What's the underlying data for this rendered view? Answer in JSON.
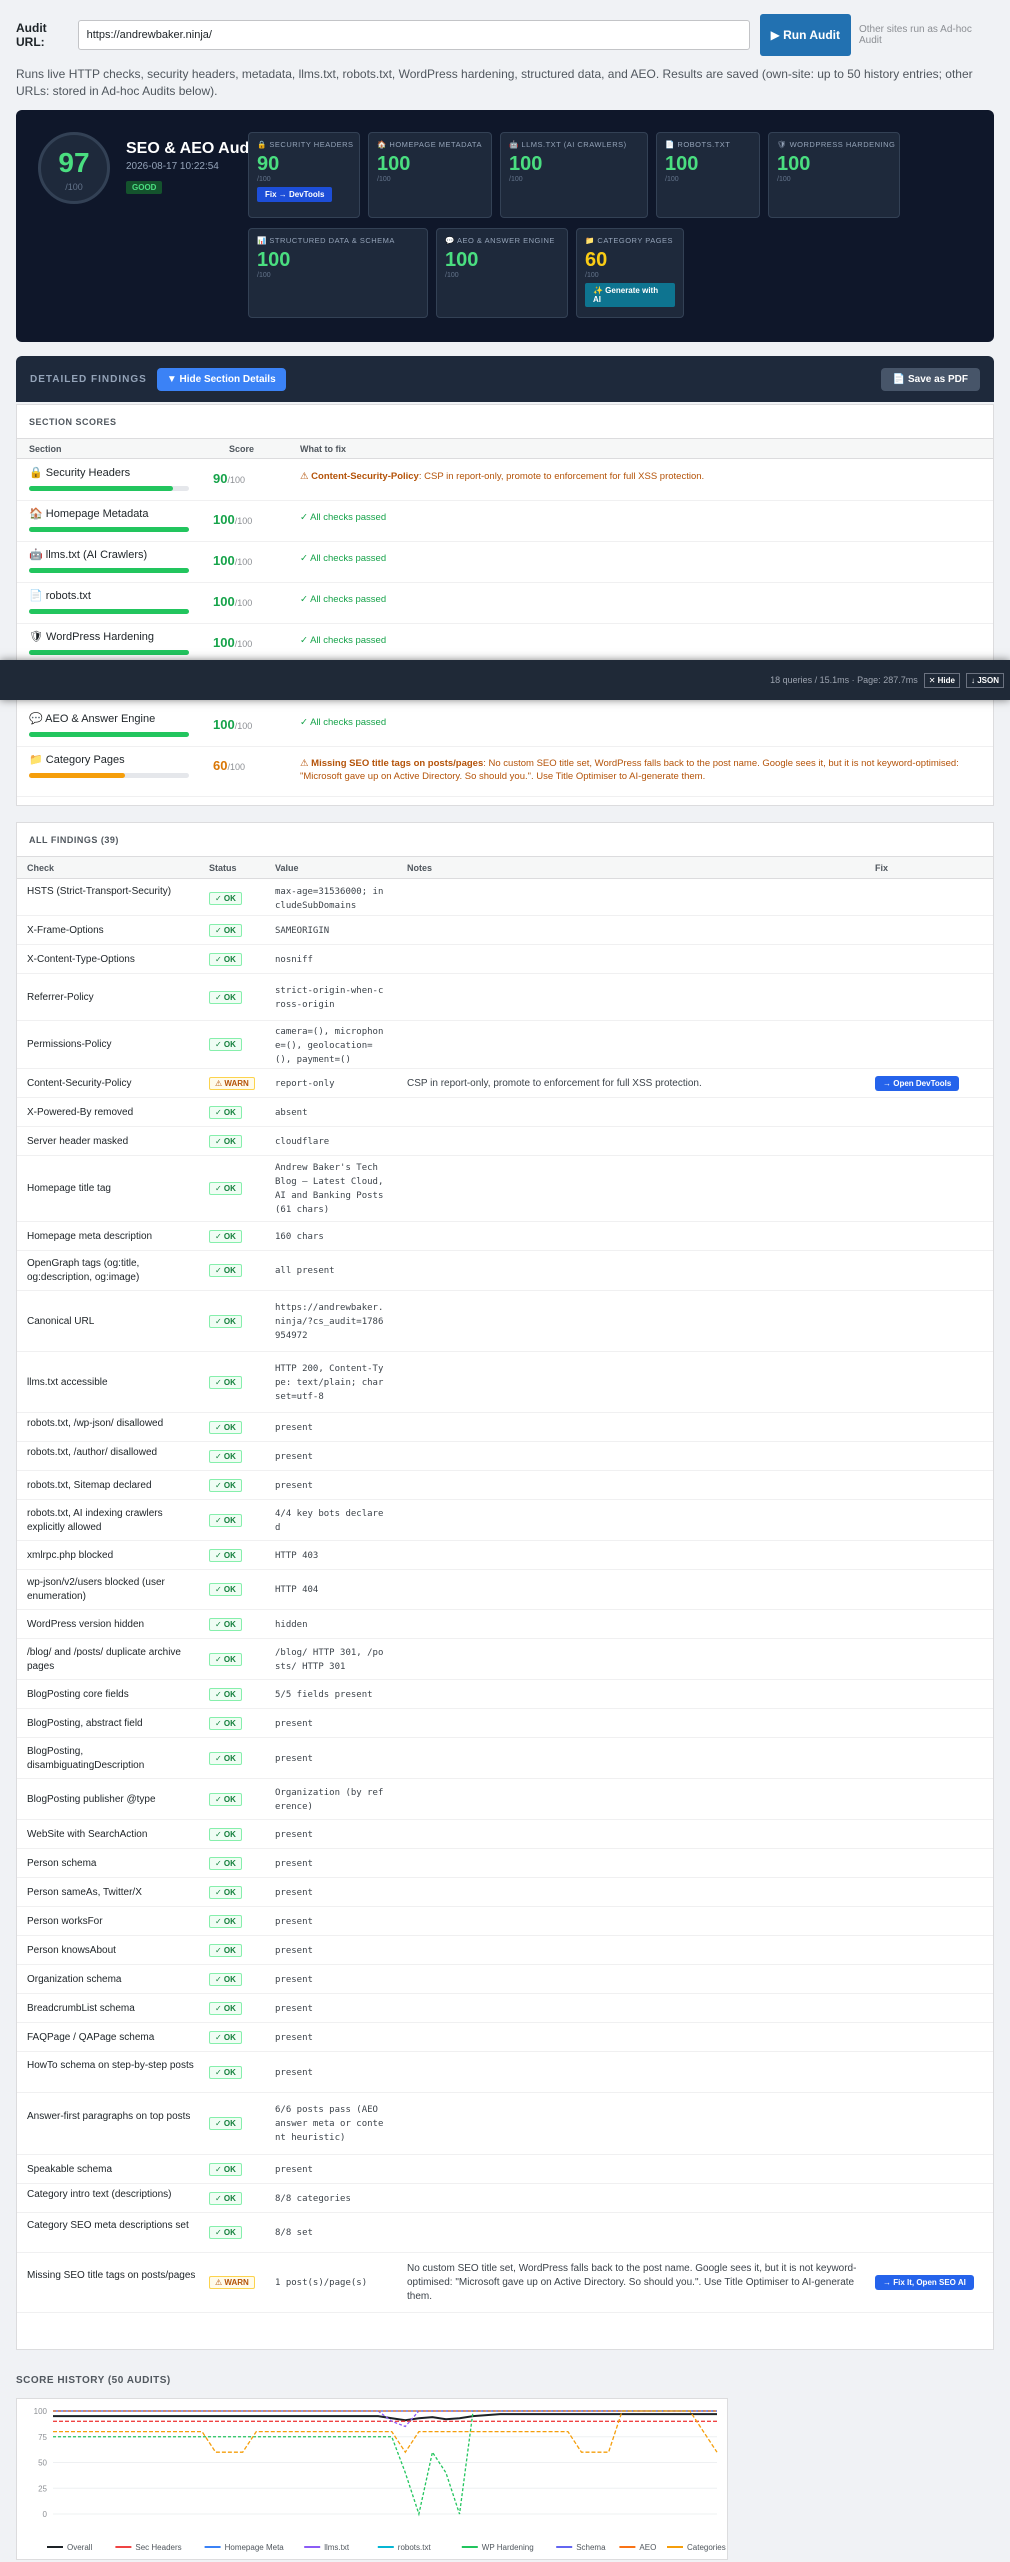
{
  "audit": {
    "url_label": "Audit URL:",
    "url_value": "https://andrewbaker.ninja/",
    "run_button": "▶ Run Audit",
    "note": "Other sites run as Ad-hoc Audit"
  },
  "intro": "Runs live HTTP checks, security headers, metadata, llms.txt, robots.txt, WordPress hardening, structured data, and AEO. Results are saved (own-site: up to 50 history entries; other URLs: stored in Ad-hoc Audits below).",
  "hero": {
    "score": "97",
    "score_denom": "/100",
    "title": "SEO & AEO Audit",
    "date": "2026-08-17 10:22:54",
    "grade": "GOOD",
    "cards": [
      {
        "title": "🔒 SECURITY HEADERS",
        "value": "90",
        "denom": "/100",
        "button": "Fix → DevTools"
      },
      {
        "title": "🏠 HOMEPAGE METADATA",
        "value": "100",
        "denom": "/100"
      },
      {
        "title": "🤖 LLMS.TXT (AI CRAWLERS)",
        "value": "100",
        "denom": "/100"
      },
      {
        "title": "📄 ROBOTS.TXT",
        "value": "100",
        "denom": "/100"
      },
      {
        "title": "🛡 WORDPRESS HARDENING",
        "value": "100",
        "denom": "/100"
      },
      {
        "title": "📊 STRUCTURED DATA & SCHEMA",
        "value": "100",
        "denom": "/100"
      },
      {
        "title": "💬 AEO & ANSWER ENGINE",
        "value": "100",
        "denom": "/100"
      },
      {
        "title": "📁 CATEGORY PAGES",
        "value": "60",
        "denom": "/100",
        "button": "✨ Generate with AI"
      }
    ]
  },
  "details": {
    "title": "DETAILED FINDINGS",
    "hide_button": "▼ Hide Section Details",
    "pdf_button": "📄 Save as PDF"
  },
  "sections": {
    "title": "SECTION SCORES",
    "col_section": "Section",
    "col_score": "Score",
    "col_fix": "What to fix",
    "rows": [
      {
        "name": "🔒 Security Headers",
        "score": "90",
        "denom": "/100",
        "fix_bold": "⚠ Content-Security-Policy",
        "fix": ": CSP in report-only, promote to enforcement for full XSS protection.",
        "pct": 0.9
      },
      {
        "name": "🏠 Homepage Metadata",
        "score": "100",
        "denom": "/100",
        "fix": "✓ All checks passed",
        "pct": 1
      },
      {
        "name": "🤖 llms.txt (AI Crawlers)",
        "score": "100",
        "denom": "/100",
        "fix": "✓ All checks passed",
        "pct": 1
      },
      {
        "name": "📄 robots.txt",
        "score": "100",
        "denom": "/100",
        "fix": "✓ All checks passed",
        "pct": 1
      },
      {
        "name": "🛡 WordPress Hardening",
        "score": "100",
        "denom": "/100",
        "fix": "✓ All checks passed",
        "pct": 1
      },
      {
        "name": "💬 AEO & Answer Engine",
        "score": "100",
        "denom": "/100",
        "fix": "✓ All checks passed",
        "pct": 1
      },
      {
        "name": "📁 Category Pages",
        "score": "60",
        "denom": "/100",
        "fix_bold": "⚠ Missing SEO title tags on posts/pages",
        "fix": ": No custom SEO title set, WordPress falls back to the post name. Google sees it, but it is not keyword-optimised: \"Microsoft gave up on Active Directory. So should you.\". Use Title Optimiser to AI-generate them.",
        "pct": 0.6
      }
    ]
  },
  "debug": {
    "text": "18 queries / 15.1ms · Page: 287.7ms",
    "hide": "✕ Hide",
    "json": "↓ JSON"
  },
  "findings": {
    "title": "ALL FINDINGS (39)",
    "cols": [
      "Check",
      "Status",
      "Value",
      "Notes",
      "Fix"
    ],
    "rows": [
      {
        "check": "HSTS (Strict-Transport-Security)",
        "status": "✓ OK",
        "value": "max-age=31536000; includeSubDomains"
      },
      {
        "check": "X-Frame-Options",
        "status": "✓ OK",
        "value": "SAMEORIGIN"
      },
      {
        "check": "X-Content-Type-Options",
        "status": "✓ OK",
        "value": "nosniff"
      },
      {
        "check": "Referrer-Policy",
        "status": "✓ OK",
        "value": "strict-origin-when-cross-origin"
      },
      {
        "check": "Permissions-Policy",
        "status": "✓ OK",
        "value": "camera=(), microphone=(), geolocation=(), payment=()"
      },
      {
        "check": "Content-Security-Policy",
        "status": "⚠ WARN",
        "value": "report-only",
        "notes": "CSP in report-only, promote to enforcement for full XSS protection.",
        "fix": "→ Open DevTools"
      },
      {
        "check": "X-Powered-By removed",
        "status": "✓ OK",
        "value": "absent"
      },
      {
        "check": "Server header masked",
        "status": "✓ OK",
        "value": "cloudflare"
      },
      {
        "check": "Homepage title tag",
        "status": "✓ OK",
        "value": "Andrew Baker's Tech Blog – Latest Cloud, AI and Banking Posts (61 chars)"
      },
      {
        "check": "Homepage meta description",
        "status": "✓ OK",
        "value": "160 chars"
      },
      {
        "check": "OpenGraph tags (og:title, og:description, og:image)",
        "status": "✓ OK",
        "value": "all present"
      },
      {
        "check": "Canonical URL",
        "status": "✓ OK",
        "value": "https://andrewbaker.ninja/?cs_audit=1786954972"
      },
      {
        "check": "llms.txt accessible",
        "status": "✓ OK",
        "value": "HTTP 200, Content-Type: text/plain; charset=utf-8"
      },
      {
        "check": "robots.txt, /wp-json/ disallowed",
        "status": "✓ OK",
        "value": "present"
      },
      {
        "check": "robots.txt, /author/ disallowed",
        "status": "✓ OK",
        "value": "present"
      },
      {
        "check": "robots.txt, Sitemap declared",
        "status": "✓ OK",
        "value": "present"
      },
      {
        "check": "robots.txt, AI indexing crawlers explicitly allowed",
        "status": "✓ OK",
        "value": "4/4 key bots declared"
      },
      {
        "check": "xmlrpc.php blocked",
        "status": "✓ OK",
        "value": "HTTP 403"
      },
      {
        "check": "wp-json/v2/users blocked (user enumeration)",
        "status": "✓ OK",
        "value": "HTTP 404"
      },
      {
        "check": "WordPress version hidden",
        "status": "✓ OK",
        "value": "hidden"
      },
      {
        "check": "/blog/ and /posts/ duplicate archive pages",
        "status": "✓ OK",
        "value": "/blog/ HTTP 301, /posts/ HTTP 301"
      },
      {
        "check": "BlogPosting core fields",
        "status": "✓ OK",
        "value": "5/5 fields present"
      },
      {
        "check": "BlogPosting, abstract field",
        "status": "✓ OK",
        "value": "present"
      },
      {
        "check": "BlogPosting, disambiguatingDescription",
        "status": "✓ OK",
        "value": "present"
      },
      {
        "check": "BlogPosting publisher @type",
        "status": "✓ OK",
        "value": "Organization (by reference)"
      },
      {
        "check": "WebSite with SearchAction",
        "status": "✓ OK",
        "value": "present"
      },
      {
        "check": "Person schema",
        "status": "✓ OK",
        "value": "present"
      },
      {
        "check": "Person sameAs, Twitter/X",
        "status": "✓ OK",
        "value": "present"
      },
      {
        "check": "Person worksFor",
        "status": "✓ OK",
        "value": "present"
      },
      {
        "check": "Person knowsAbout",
        "status": "✓ OK",
        "value": "present"
      },
      {
        "check": "Organization schema",
        "status": "✓ OK",
        "value": "present"
      },
      {
        "check": "BreadcrumbList schema",
        "status": "✓ OK",
        "value": "present"
      },
      {
        "check": "FAQPage / QAPage schema",
        "status": "✓ OK",
        "value": "present"
      },
      {
        "check": "HowTo schema on step-by-step posts",
        "status": "✓ OK",
        "value": "present"
      },
      {
        "check": "Answer-first paragraphs on top posts",
        "status": "✓ OK",
        "value": "6/6 posts pass (AEO answer meta or content heuristic)"
      },
      {
        "check": "Speakable schema",
        "status": "✓ OK",
        "value": "present"
      },
      {
        "check": "Category intro text (descriptions)",
        "status": "✓ OK",
        "value": "8/8 categories"
      },
      {
        "check": "Category SEO meta descriptions set",
        "status": "✓ OK",
        "value": "8/8 set"
      },
      {
        "check": "Missing SEO title tags on posts/pages",
        "status": "⚠ WARN",
        "value": "1 post(s)/page(s)",
        "notes": "No custom SEO title set, WordPress falls back to the post name. Google sees it, but it is not keyword-optimised: \"Microsoft gave up on Active Directory. So should you.\". Use Title Optimiser to AI-generate them.",
        "fix": "→ Fix It, Open SEO AI"
      }
    ]
  },
  "history": {
    "title": "SCORE HISTORY (50 AUDITS)",
    "yticks": [
      "100",
      "75",
      "50",
      "25",
      "0"
    ],
    "legend": [
      "Overall",
      "Sec Headers",
      "Homepage Meta",
      "llms.txt",
      "robots.txt",
      "WP Hardening",
      "Schema",
      "AEO",
      "Categories"
    ],
    "colors": [
      "#1d2327",
      "#ef4444",
      "#3b82f6",
      "#8b5cf6",
      "#06b6d4",
      "#22c55e",
      "#6366f1",
      "#f97316",
      "#f59e0b"
    ]
  },
  "chart_data": {
    "type": "line",
    "title": "SCORE HISTORY (50 AUDITS)",
    "ylim": [
      0,
      100
    ],
    "series": [
      {
        "name": "Overall",
        "values": [
          95,
          95,
          95,
          95,
          95,
          95,
          95,
          95,
          95,
          95,
          95,
          95,
          95,
          95,
          95,
          95,
          95,
          95,
          95,
          95,
          95,
          95,
          95,
          95,
          95,
          93,
          91,
          93,
          94,
          92,
          93,
          95,
          96,
          97,
          97,
          97,
          97,
          97,
          97,
          97,
          97,
          97,
          97,
          97,
          97,
          97,
          97,
          97,
          97,
          97
        ]
      },
      {
        "name": "Sec Headers",
        "values": [
          90,
          90,
          90,
          90,
          90,
          90,
          90,
          90,
          90,
          90,
          90,
          90,
          90,
          90,
          90,
          90,
          90,
          90,
          90,
          90,
          90,
          90,
          90,
          90,
          90,
          90,
          90,
          90,
          90,
          90,
          90,
          90,
          90,
          90,
          90,
          90,
          90,
          90,
          90,
          90,
          90,
          90,
          90,
          90,
          90,
          90,
          90,
          90,
          90,
          90
        ]
      },
      {
        "name": "llms.txt",
        "values": [
          100,
          100,
          100,
          100,
          100,
          100,
          100,
          100,
          100,
          100,
          100,
          100,
          100,
          100,
          100,
          100,
          100,
          100,
          100,
          100,
          100,
          100,
          100,
          100,
          100,
          90,
          85,
          100,
          100,
          100,
          100,
          100,
          100,
          100,
          100,
          100,
          100,
          100,
          100,
          100,
          100,
          100,
          100,
          100,
          100,
          100,
          100,
          100,
          100,
          100
        ]
      },
      {
        "name": "robots.txt",
        "values": [
          100,
          100,
          100,
          100,
          100,
          100,
          100,
          100,
          100,
          100,
          100,
          100,
          100,
          100,
          100,
          100,
          100,
          100,
          100,
          100,
          100,
          100,
          100,
          100,
          100,
          100,
          100,
          100,
          100,
          100,
          100,
          100,
          100,
          100,
          100,
          100,
          100,
          100,
          100,
          100,
          100,
          100,
          100,
          100,
          100,
          100,
          100,
          100,
          100,
          100
        ]
      },
      {
        "name": "WP Hardening",
        "values": [
          75,
          75,
          75,
          75,
          75,
          75,
          75,
          75,
          75,
          75,
          75,
          75,
          75,
          75,
          75,
          75,
          75,
          75,
          75,
          75,
          75,
          75,
          75,
          75,
          75,
          75,
          40,
          0,
          60,
          40,
          0,
          100,
          100,
          100,
          100,
          100,
          100,
          100,
          100,
          100,
          100,
          100,
          100,
          100,
          100,
          100,
          100,
          100,
          100,
          100
        ]
      },
      {
        "name": "Schema",
        "values": [
          100,
          100,
          100,
          100,
          100,
          100,
          100,
          100,
          100,
          100,
          100,
          100,
          100,
          100,
          100,
          100,
          100,
          100,
          100,
          100,
          100,
          100,
          100,
          100,
          100,
          100,
          100,
          100,
          100,
          100,
          100,
          100,
          100,
          100,
          100,
          100,
          100,
          100,
          100,
          100,
          100,
          100,
          100,
          100,
          100,
          100,
          100,
          100,
          100,
          100
        ]
      },
      {
        "name": "AEO",
        "values": [
          100,
          100,
          100,
          100,
          100,
          100,
          100,
          100,
          100,
          100,
          100,
          100,
          100,
          100,
          100,
          100,
          100,
          100,
          100,
          100,
          100,
          100,
          100,
          100,
          100,
          100,
          100,
          100,
          100,
          100,
          100,
          100,
          100,
          100,
          100,
          100,
          100,
          100,
          100,
          100,
          100,
          100,
          100,
          100,
          100,
          100,
          100,
          100,
          100,
          100
        ]
      },
      {
        "name": "Categories",
        "values": [
          80,
          80,
          80,
          80,
          80,
          80,
          80,
          80,
          80,
          80,
          80,
          80,
          60,
          60,
          60,
          80,
          80,
          80,
          80,
          80,
          80,
          80,
          80,
          80,
          80,
          80,
          60,
          80,
          80,
          80,
          80,
          80,
          80,
          80,
          80,
          80,
          80,
          80,
          80,
          60,
          60,
          60,
          100,
          100,
          100,
          100,
          100,
          100,
          80,
          60
        ]
      }
    ]
  }
}
